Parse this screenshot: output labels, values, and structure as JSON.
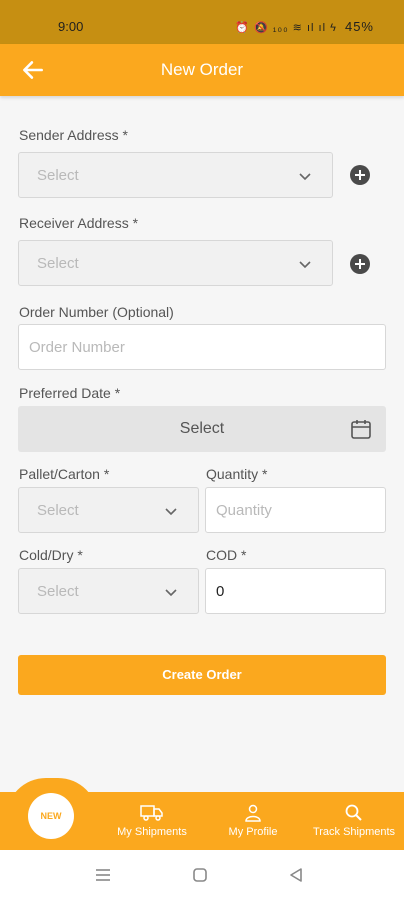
{
  "status_bar": {
    "time": "9:00",
    "icons": "⏰ 🔕 ₁₀₀ ≋ ıl ıl ϟ",
    "battery": "45%"
  },
  "app_bar": {
    "title": "New Order"
  },
  "form": {
    "sender": {
      "label": "Sender Address *",
      "placeholder": "Select"
    },
    "receiver": {
      "label": "Receiver Address *",
      "placeholder": "Select"
    },
    "order_number": {
      "label": "Order Number (Optional)",
      "placeholder": "Order Number"
    },
    "preferred_date": {
      "label": "Preferred Date *",
      "value": "Select"
    },
    "pallet": {
      "label": "Pallet/Carton *",
      "placeholder": "Select"
    },
    "quantity": {
      "label": "Quantity *",
      "placeholder": "Quantity"
    },
    "cold_dry": {
      "label": "Cold/Dry *",
      "placeholder": "Select"
    },
    "cod": {
      "label": "COD *",
      "value": "0"
    },
    "submit_label": "Create Order"
  },
  "bottom_nav": {
    "new_label": "NEW",
    "items": [
      {
        "label": "My Shipments",
        "icon": "truck-icon"
      },
      {
        "label": "My Profile",
        "icon": "person-icon"
      },
      {
        "label": "Track Shipments",
        "icon": "search-icon"
      }
    ]
  },
  "colors": {
    "accent": "#fba81e",
    "status_bar": "#c68f12",
    "background": "#f6f6f6"
  }
}
